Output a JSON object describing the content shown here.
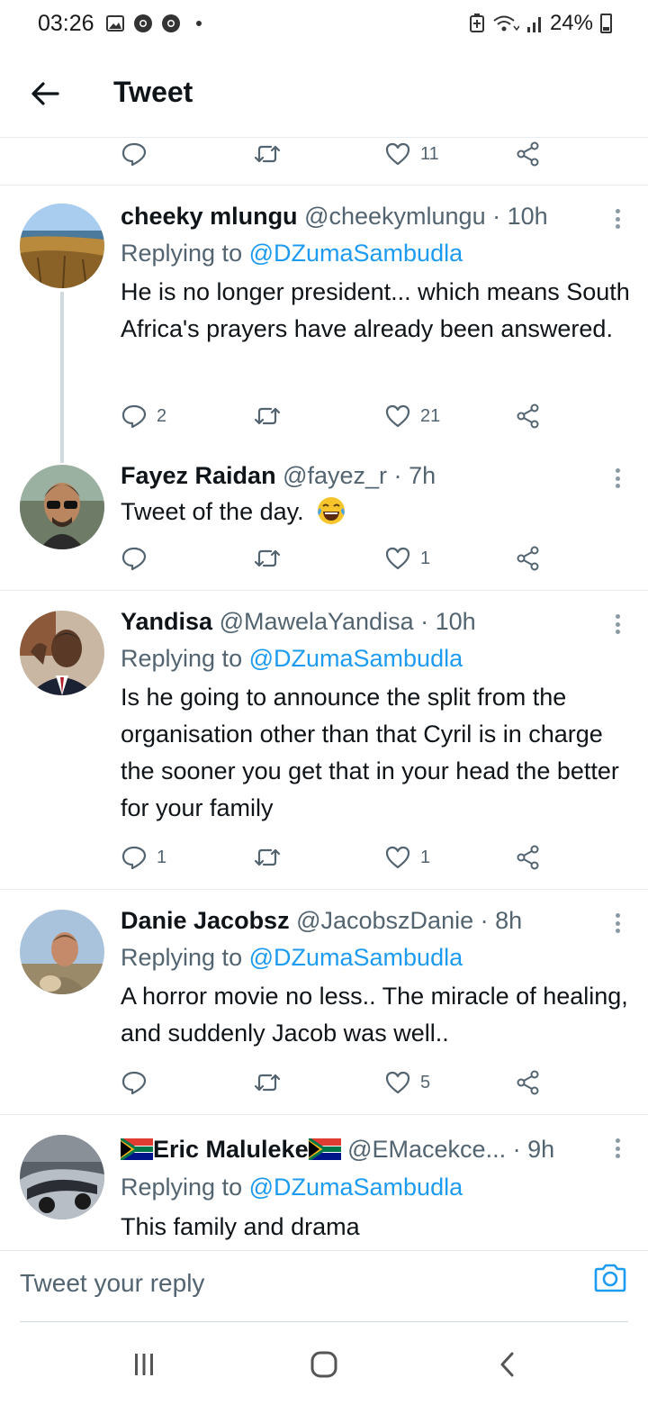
{
  "status_bar": {
    "time": "03:26",
    "battery": "24%",
    "icons": [
      "gallery-icon",
      "chrome-icon",
      "chrome-icon",
      "notification-dot",
      "battery-saver-icon",
      "wifi-icon",
      "signal-icon",
      "battery-icon"
    ]
  },
  "header": {
    "title": "Tweet",
    "back_icon": "arrow-left-icon"
  },
  "colors": {
    "accent": "#1d9bf0",
    "text": "#0f1419",
    "secondary": "#536471",
    "divider": "#e6ecf0"
  },
  "top_actions": {
    "reply_count": "",
    "retweet_count": "",
    "like_count": "11"
  },
  "tweets": [
    {
      "name": "cheeky mlungu",
      "handle": "@cheekymlungu",
      "sep": "·",
      "time": "10h",
      "replying_prefix": "Replying to ",
      "replying_to": "@DZumaSambudla",
      "text": "He is no longer president... which means South Africa's prayers have already been answered.",
      "reply_count": "2",
      "retweet_count": "",
      "like_count": "21"
    },
    {
      "name": "Fayez Raidan",
      "handle": "@fayez_r",
      "sep": "·",
      "time": "7h",
      "text": "Tweet of the day.",
      "emoji": "face-with-tears-of-joy",
      "reply_count": "",
      "retweet_count": "",
      "like_count": "1"
    },
    {
      "name": "Yandisa",
      "handle": "@MawelaYandisa",
      "sep": "·",
      "time": "10h",
      "replying_prefix": "Replying to ",
      "replying_to": "@DZumaSambudla",
      "text": "Is he going to announce the split from the organisation other than that Cyril is in charge the sooner you get that in your head the better for your family",
      "reply_count": "1",
      "retweet_count": "",
      "like_count": "1"
    },
    {
      "name": "Danie Jacobsz",
      "handle": "@JacobszDanie",
      "sep": "·",
      "time": "8h",
      "replying_prefix": "Replying to ",
      "replying_to": "@DZumaSambudla",
      "text": "A horror movie no less.. The miracle of healing, and suddenly Jacob was well..",
      "reply_count": "",
      "retweet_count": "",
      "like_count": "5"
    },
    {
      "name": "Eric Maluleke",
      "handle": "@EMacekce...",
      "sep": "·",
      "time": "9h",
      "replying_prefix": "Replying to ",
      "replying_to": "@DZumaSambudla",
      "text": "This family and drama"
    }
  ],
  "composer": {
    "placeholder": "Tweet your reply"
  },
  "nav_bar": {
    "icons": [
      "recent-apps-icon",
      "home-icon",
      "back-icon"
    ]
  }
}
